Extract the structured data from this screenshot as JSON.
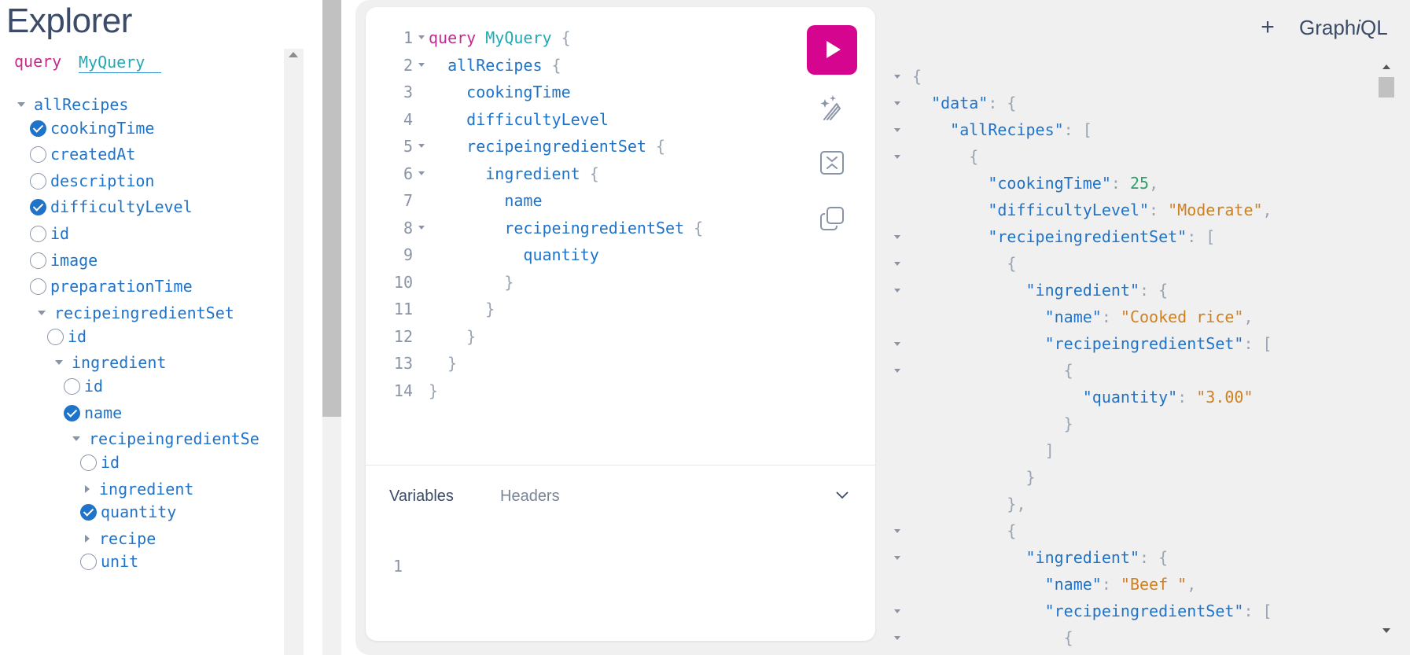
{
  "explorer": {
    "title": "Explorer",
    "operation_keyword": "query",
    "operation_name": "MyQuery",
    "tree": [
      {
        "label": "allRecipes",
        "state": "expanded"
      },
      {
        "label": "cookingTime",
        "state": "checked"
      },
      {
        "label": "createdAt",
        "state": "unchecked"
      },
      {
        "label": "description",
        "state": "unchecked"
      },
      {
        "label": "difficultyLevel",
        "state": "checked"
      },
      {
        "label": "id",
        "state": "unchecked"
      },
      {
        "label": "image",
        "state": "unchecked"
      },
      {
        "label": "preparationTime",
        "state": "unchecked"
      },
      {
        "label": "recipeingredientSet",
        "state": "expanded"
      },
      {
        "label": "id",
        "state": "unchecked"
      },
      {
        "label": "ingredient",
        "state": "expanded"
      },
      {
        "label": "id",
        "state": "unchecked"
      },
      {
        "label": "name",
        "state": "checked"
      },
      {
        "label": "recipeingredientSe",
        "state": "expanded"
      },
      {
        "label": "id",
        "state": "unchecked"
      },
      {
        "label": "ingredient",
        "state": "collapsed"
      },
      {
        "label": "quantity",
        "state": "checked"
      },
      {
        "label": "recipe",
        "state": "collapsed"
      },
      {
        "label": "unit",
        "state": "unchecked"
      }
    ]
  },
  "editor": {
    "lines": [
      {
        "n": "1",
        "fold": true,
        "tokens": [
          {
            "t": "query ",
            "c": "kw"
          },
          {
            "t": "MyQuery ",
            "c": "def"
          },
          {
            "t": "{",
            "c": "pn"
          }
        ]
      },
      {
        "n": "2",
        "fold": true,
        "tokens": [
          {
            "t": "  allRecipes ",
            "c": "fld"
          },
          {
            "t": "{",
            "c": "pn"
          }
        ]
      },
      {
        "n": "3",
        "fold": false,
        "tokens": [
          {
            "t": "    cookingTime",
            "c": "fld"
          }
        ]
      },
      {
        "n": "4",
        "fold": false,
        "tokens": [
          {
            "t": "    difficultyLevel",
            "c": "fld"
          }
        ]
      },
      {
        "n": "5",
        "fold": true,
        "tokens": [
          {
            "t": "    recipeingredientSet ",
            "c": "fld"
          },
          {
            "t": "{",
            "c": "pn"
          }
        ]
      },
      {
        "n": "6",
        "fold": true,
        "tokens": [
          {
            "t": "      ingredient ",
            "c": "fld"
          },
          {
            "t": "{",
            "c": "pn"
          }
        ]
      },
      {
        "n": "7",
        "fold": false,
        "tokens": [
          {
            "t": "        name",
            "c": "fld"
          }
        ]
      },
      {
        "n": "8",
        "fold": true,
        "tokens": [
          {
            "t": "        recipeingredientSet ",
            "c": "fld"
          },
          {
            "t": "{",
            "c": "pn"
          }
        ]
      },
      {
        "n": "9",
        "fold": false,
        "tokens": [
          {
            "t": "          quantity",
            "c": "fld"
          }
        ]
      },
      {
        "n": "10",
        "fold": false,
        "tokens": [
          {
            "t": "        }",
            "c": "pn"
          }
        ]
      },
      {
        "n": "11",
        "fold": false,
        "tokens": [
          {
            "t": "      }",
            "c": "pn"
          }
        ]
      },
      {
        "n": "12",
        "fold": false,
        "tokens": [
          {
            "t": "    }",
            "c": "pn"
          }
        ]
      },
      {
        "n": "13",
        "fold": false,
        "tokens": [
          {
            "t": "  }",
            "c": "pn"
          }
        ]
      },
      {
        "n": "14",
        "fold": false,
        "tokens": [
          {
            "t": "}",
            "c": "pn"
          }
        ]
      }
    ],
    "tabs": {
      "variables": "Variables",
      "headers": "Headers"
    },
    "variables_line": "1"
  },
  "toolbar": {
    "add_tab": "+",
    "logo_prefix": "Graph",
    "logo_italic": "i",
    "logo_suffix": "QL"
  },
  "result": {
    "lines": [
      {
        "fold": true,
        "tokens": [
          {
            "t": "{",
            "c": "rpn"
          }
        ]
      },
      {
        "fold": true,
        "tokens": [
          {
            "t": "  \"data\"",
            "c": "rkey"
          },
          {
            "t": ": {",
            "c": "rpn"
          }
        ]
      },
      {
        "fold": true,
        "tokens": [
          {
            "t": "    \"allRecipes\"",
            "c": "rkey"
          },
          {
            "t": ": [",
            "c": "rpn"
          }
        ]
      },
      {
        "fold": true,
        "tokens": [
          {
            "t": "      {",
            "c": "rpn"
          }
        ]
      },
      {
        "fold": false,
        "tokens": [
          {
            "t": "        \"cookingTime\"",
            "c": "rkey"
          },
          {
            "t": ": ",
            "c": "rpn"
          },
          {
            "t": "25",
            "c": "rnum"
          },
          {
            "t": ",",
            "c": "rpn"
          }
        ]
      },
      {
        "fold": false,
        "tokens": [
          {
            "t": "        \"difficultyLevel\"",
            "c": "rkey"
          },
          {
            "t": ": ",
            "c": "rpn"
          },
          {
            "t": "\"Moderate\"",
            "c": "rstr"
          },
          {
            "t": ",",
            "c": "rpn"
          }
        ]
      },
      {
        "fold": true,
        "tokens": [
          {
            "t": "        \"recipeingredientSet\"",
            "c": "rkey"
          },
          {
            "t": ": [",
            "c": "rpn"
          }
        ]
      },
      {
        "fold": true,
        "tokens": [
          {
            "t": "          {",
            "c": "rpn"
          }
        ]
      },
      {
        "fold": true,
        "tokens": [
          {
            "t": "            \"ingredient\"",
            "c": "rkey"
          },
          {
            "t": ": {",
            "c": "rpn"
          }
        ]
      },
      {
        "fold": false,
        "tokens": [
          {
            "t": "              \"name\"",
            "c": "rkey"
          },
          {
            "t": ": ",
            "c": "rpn"
          },
          {
            "t": "\"Cooked rice\"",
            "c": "rstr"
          },
          {
            "t": ",",
            "c": "rpn"
          }
        ]
      },
      {
        "fold": true,
        "tokens": [
          {
            "t": "              \"recipeingredientSet\"",
            "c": "rkey"
          },
          {
            "t": ": [",
            "c": "rpn"
          }
        ]
      },
      {
        "fold": true,
        "tokens": [
          {
            "t": "                {",
            "c": "rpn"
          }
        ]
      },
      {
        "fold": false,
        "tokens": [
          {
            "t": "                  \"quantity\"",
            "c": "rkey"
          },
          {
            "t": ": ",
            "c": "rpn"
          },
          {
            "t": "\"3.00\"",
            "c": "rstr"
          }
        ]
      },
      {
        "fold": false,
        "tokens": [
          {
            "t": "                }",
            "c": "rpn"
          }
        ]
      },
      {
        "fold": false,
        "tokens": [
          {
            "t": "              ]",
            "c": "rpn"
          }
        ]
      },
      {
        "fold": false,
        "tokens": [
          {
            "t": "            }",
            "c": "rpn"
          }
        ]
      },
      {
        "fold": false,
        "tokens": [
          {
            "t": "          },",
            "c": "rpn"
          }
        ]
      },
      {
        "fold": true,
        "tokens": [
          {
            "t": "          {",
            "c": "rpn"
          }
        ]
      },
      {
        "fold": true,
        "tokens": [
          {
            "t": "            \"ingredient\"",
            "c": "rkey"
          },
          {
            "t": ": {",
            "c": "rpn"
          }
        ]
      },
      {
        "fold": false,
        "tokens": [
          {
            "t": "              \"name\"",
            "c": "rkey"
          },
          {
            "t": ": ",
            "c": "rpn"
          },
          {
            "t": "\"Beef \"",
            "c": "rstr"
          },
          {
            "t": ",",
            "c": "rpn"
          }
        ]
      },
      {
        "fold": true,
        "tokens": [
          {
            "t": "              \"recipeingredientSet\"",
            "c": "rkey"
          },
          {
            "t": ": [",
            "c": "rpn"
          }
        ]
      },
      {
        "fold": true,
        "tokens": [
          {
            "t": "                {",
            "c": "rpn"
          }
        ]
      }
    ]
  },
  "colors": {
    "run_button": "#d60590",
    "field": "#1f73c8",
    "keyword": "#c22b8f",
    "def": "#23a9b4",
    "string": "#d0801f",
    "number": "#2e9e6a"
  }
}
